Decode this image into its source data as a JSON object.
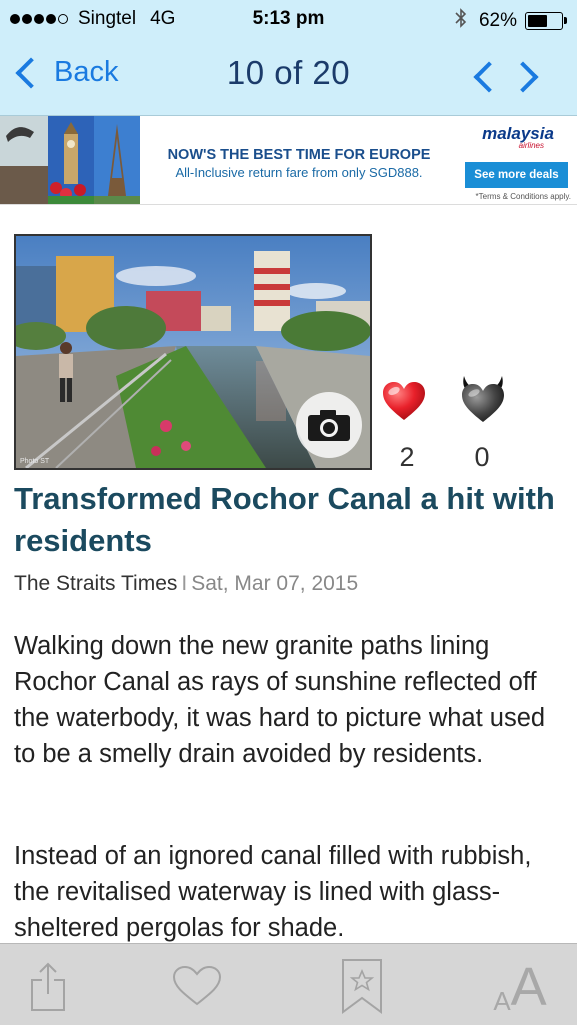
{
  "status_bar": {
    "carrier": "Singtel",
    "network": "4G",
    "time": "5:13 pm",
    "battery": "62%",
    "battery_level": 0.62,
    "signal_bars": 4,
    "signal_max": 5,
    "bluetooth_icon": "bluetooth-icon"
  },
  "nav": {
    "back_label": "Back",
    "position": "10 of 20",
    "prev_icon": "chevron-left-icon",
    "next_icon": "chevron-right-icon",
    "accent": "#1a7ae0"
  },
  "ad": {
    "headline": "NOW'S THE BEST TIME FOR EUROPE",
    "subline": "All-Inclusive return fare from only SGD888.",
    "brand": "malaysia",
    "brand_sub": "airlines",
    "cta": "See more deals",
    "terms": "*Terms & Conditions apply."
  },
  "article": {
    "photo_credit": "Photo ST",
    "photo_badge_icon": "camera-icon",
    "likes": "2",
    "dislikes": "0",
    "like_icon": "heart-icon",
    "dislike_icon": "devil-heart-icon",
    "title": "Transformed Rochor Canal a hit with residents",
    "source": "The Straits Times",
    "separator": "I",
    "date": "Sat, Mar 07, 2015",
    "paragraphs": [
      "Walking down the new granite paths lining Rochor Canal as rays of sunshine reflected off the waterbody, it was hard to picture what used to be a smelly drain avoided by residents.",
      "Instead of an ignored canal filled with rubbish, the revitalised waterway is lined with glass-sheltered pergolas for shade."
    ],
    "title_color": "#1b4a5f"
  },
  "toolbar": {
    "share_icon": "share-icon",
    "favorite_icon": "heart-outline-icon",
    "bookmark_icon": "bookmark-star-icon",
    "font_small": "A",
    "font_large": "A"
  }
}
